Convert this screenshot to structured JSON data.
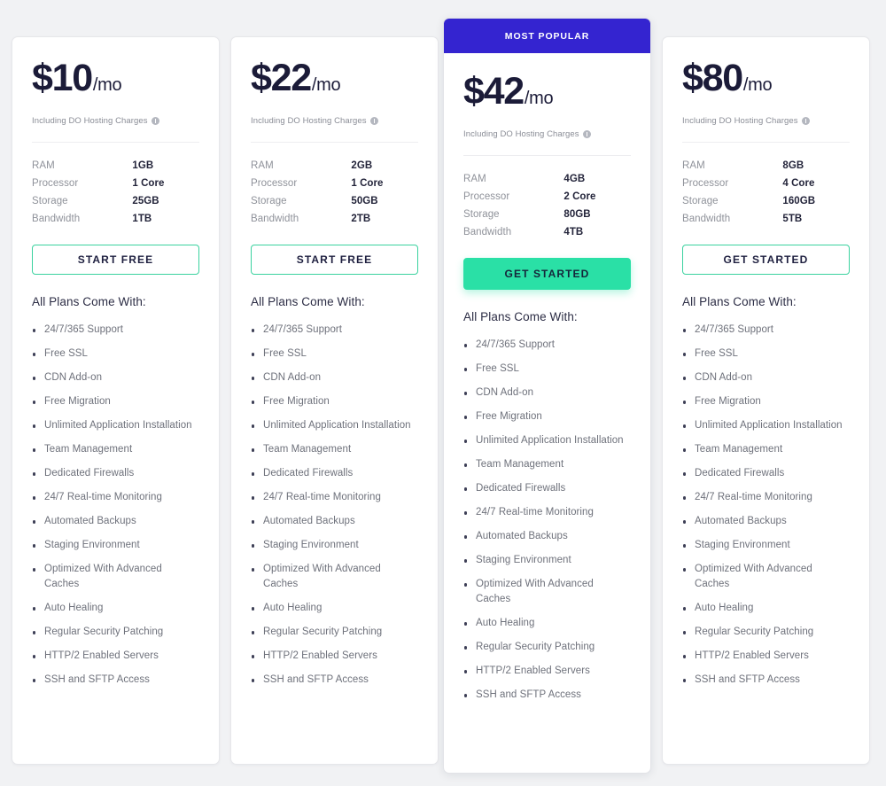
{
  "background_color": "#f1f2f4",
  "badge": {
    "label": "MOST POPULAR",
    "color": "#3424d0"
  },
  "accent_colors": {
    "green_solid": "#2ae0a6",
    "green_outline": "#3ad29f",
    "price_text": "#1b1b38"
  },
  "spec_labels": {
    "ram": "RAM",
    "processor": "Processor",
    "storage": "Storage",
    "bandwidth": "Bandwidth"
  },
  "features_title": "All Plans Come With:",
  "features": [
    "24/7/365 Support",
    "Free SSL",
    "CDN Add-on",
    "Free Migration",
    "Unlimited Application Installation",
    "Team Management",
    "Dedicated Firewalls",
    "24/7 Real-time Monitoring",
    "Automated Backups",
    "Staging Environment",
    "Optimized With Advanced Caches",
    "Auto Healing",
    "Regular Security Patching",
    "HTTP/2 Enabled Servers",
    "SSH and SFTP Access"
  ],
  "plans": [
    {
      "price_amount": "$10",
      "price_period": "/mo",
      "price_note": "Including DO Hosting Charges",
      "info_icon": "info-icon",
      "ram": "1GB",
      "processor": "1 Core",
      "storage": "25GB",
      "bandwidth": "1TB",
      "cta_label": "START FREE",
      "featured": false
    },
    {
      "price_amount": "$22",
      "price_period": "/mo",
      "price_note": "Including DO Hosting Charges",
      "info_icon": "info-icon",
      "ram": "2GB",
      "processor": "1 Core",
      "storage": "50GB",
      "bandwidth": "2TB",
      "cta_label": "START FREE",
      "featured": false
    },
    {
      "price_amount": "$42",
      "price_period": "/mo",
      "price_note": "Including DO Hosting Charges",
      "info_icon": "info-icon",
      "ram": "4GB",
      "processor": "2 Core",
      "storage": "80GB",
      "bandwidth": "4TB",
      "cta_label": "GET STARTED",
      "featured": true
    },
    {
      "price_amount": "$80",
      "price_period": "/mo",
      "price_note": "Including DO Hosting Charges",
      "info_icon": "info-icon",
      "ram": "8GB",
      "processor": "4 Core",
      "storage": "160GB",
      "bandwidth": "5TB",
      "cta_label": "GET STARTED",
      "featured": false
    }
  ]
}
